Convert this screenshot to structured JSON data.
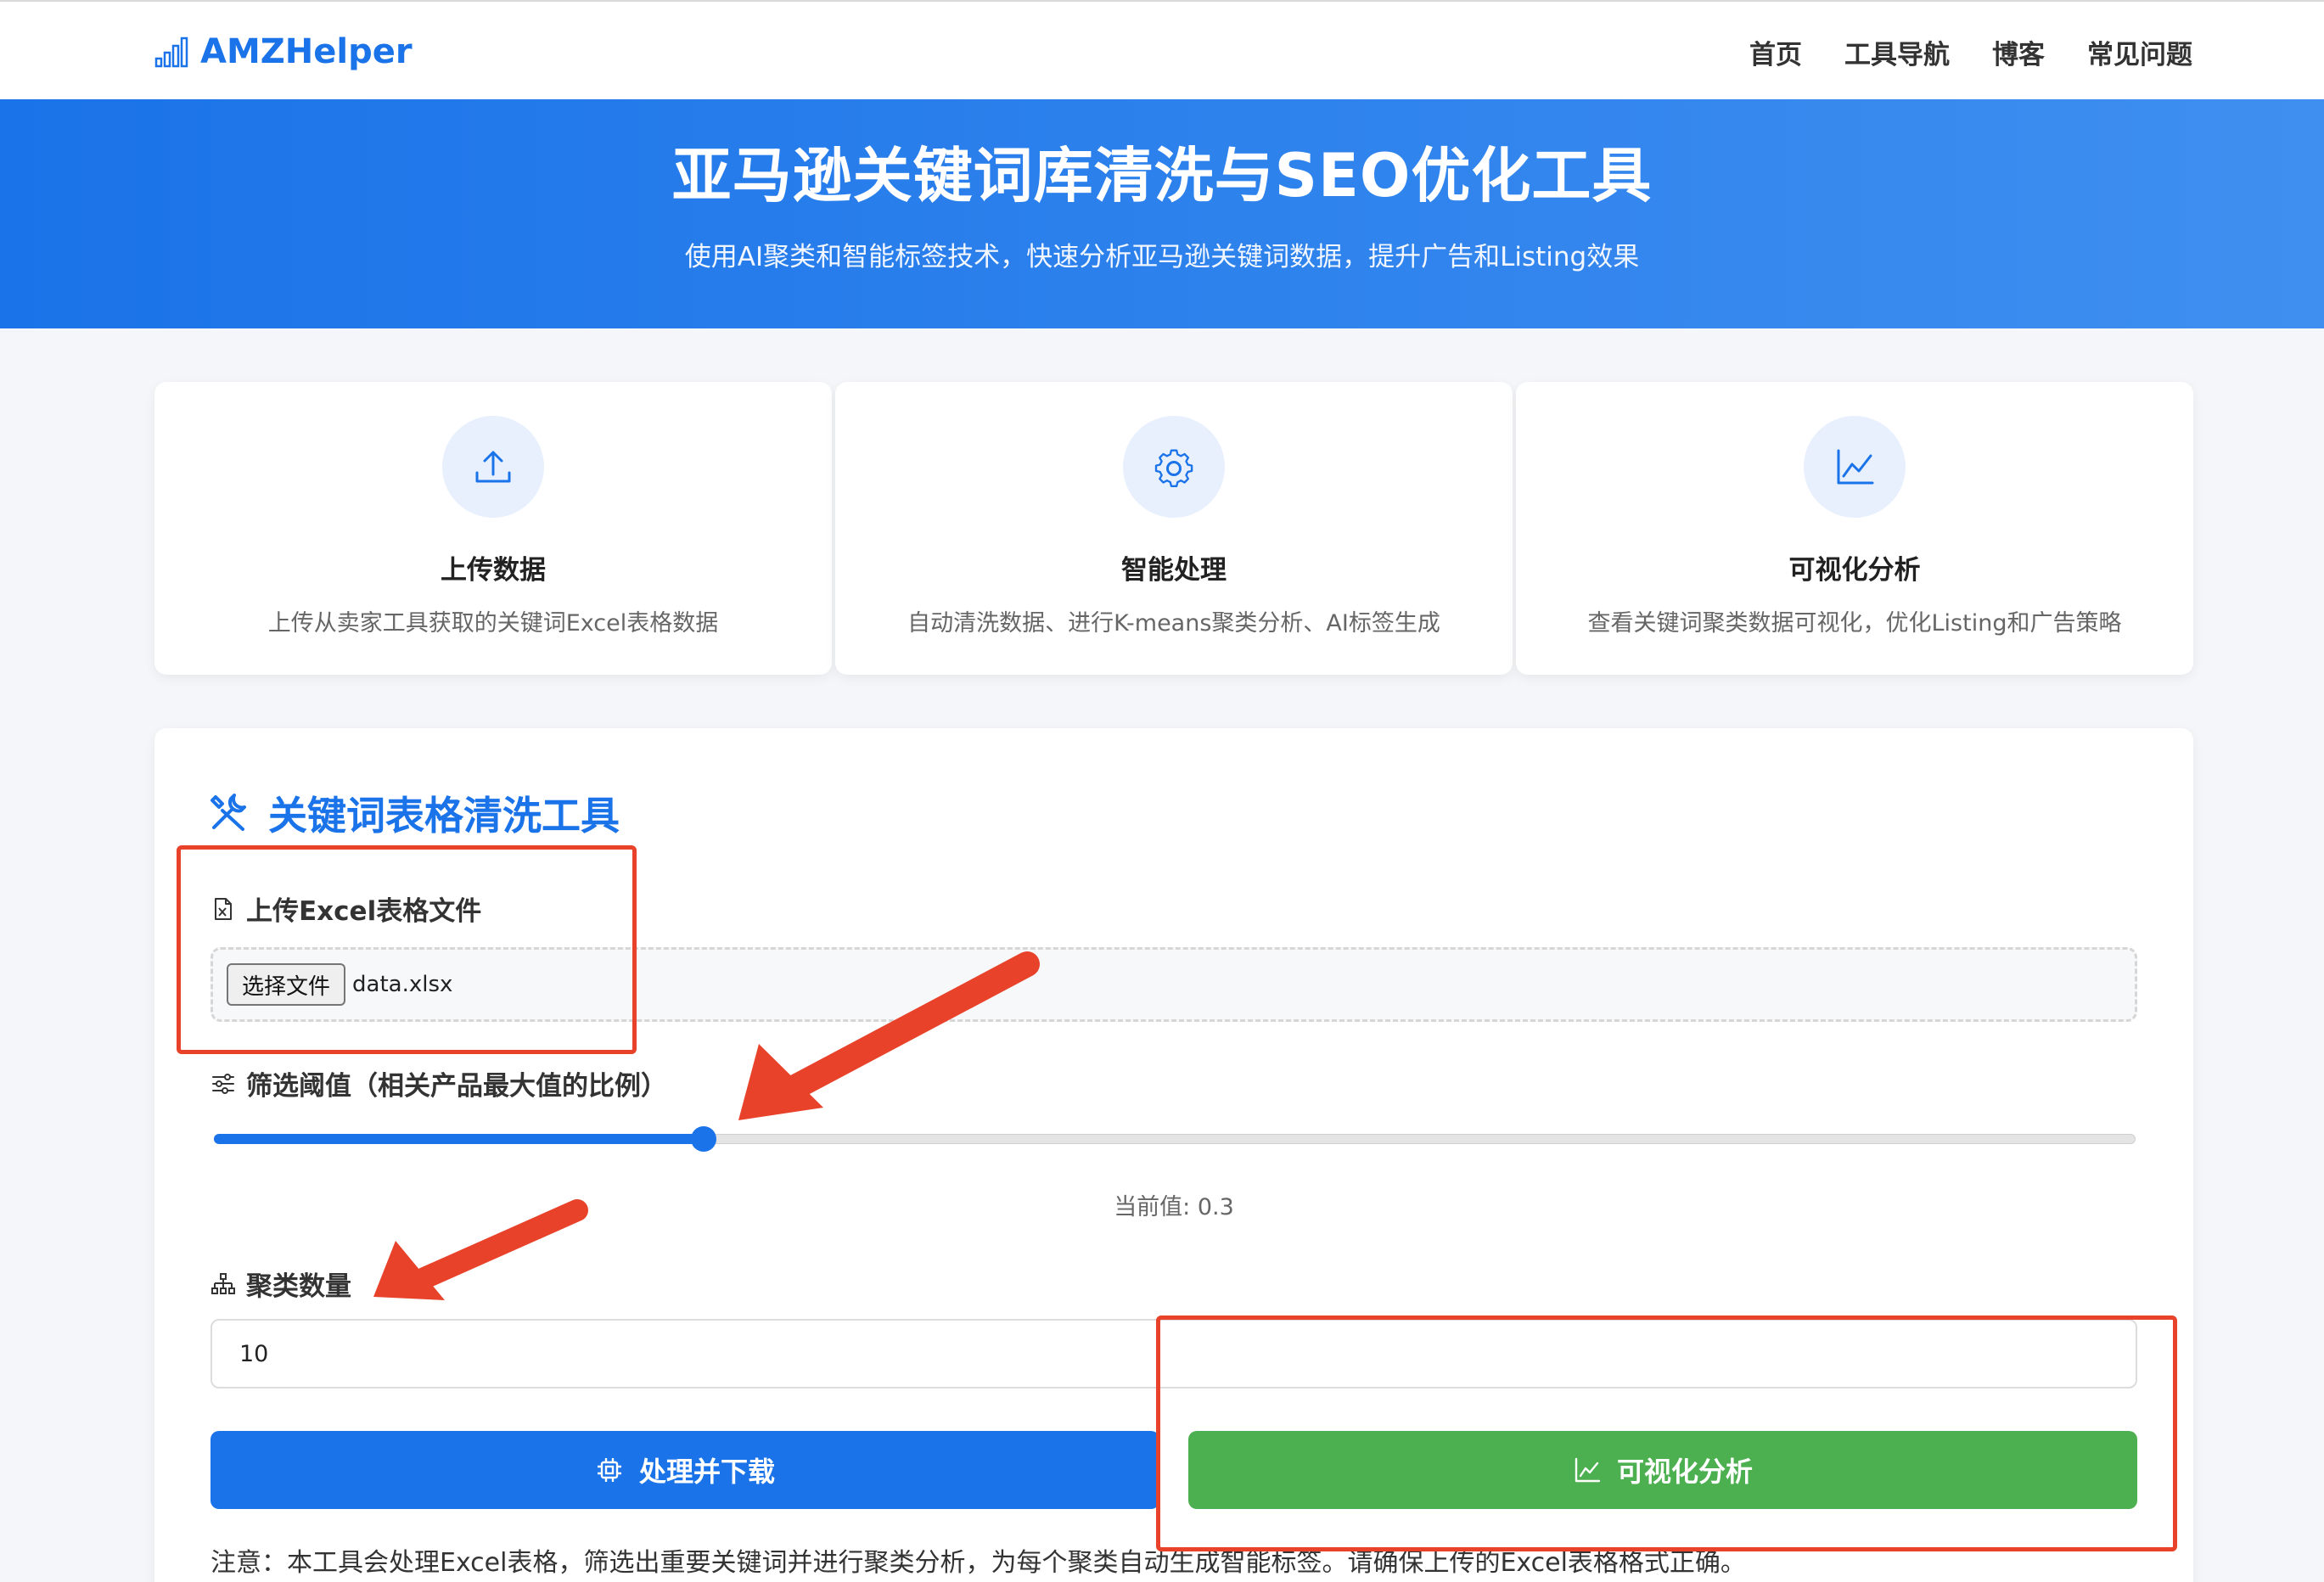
{
  "nav": {
    "brand": "AMZHelper",
    "links": [
      "首页",
      "工具导航",
      "博客",
      "常见问题"
    ]
  },
  "hero": {
    "title": "亚马逊关键词库清洗与SEO优化工具",
    "subtitle": "使用AI聚类和智能标签技术，快速分析亚马逊关键词数据，提升广告和Listing效果"
  },
  "features": [
    {
      "icon": "upload-icon",
      "title": "上传数据",
      "desc": "上传从卖家工具获取的关键词Excel表格数据"
    },
    {
      "icon": "gear-icon",
      "title": "智能处理",
      "desc": "自动清洗数据、进行K-means聚类分析、AI标签生成"
    },
    {
      "icon": "chart-line-icon",
      "title": "可视化分析",
      "desc": "查看关键词聚类数据可视化，优化Listing和广告策略"
    }
  ],
  "tool": {
    "title": "关键词表格清洗工具",
    "upload_label": "上传Excel表格文件",
    "file_button": "选择文件",
    "file_name": "data.xlsx",
    "threshold_label": "筛选阈值（相关产品最大值的比例）",
    "threshold_value": 0.3,
    "threshold_value_text": "当前值: 0.3",
    "cluster_label": "聚类数量",
    "cluster_value": "10",
    "process_button": "处理并下载",
    "visual_button": "可视化分析",
    "note": "注意：本工具会处理Excel表格，筛选出重要关键词并进行聚类分析，为每个聚类自动生成智能标签。请确保上传的Excel表格格式正确。"
  },
  "colors": {
    "primary": "#1a73e8",
    "success": "#4caf50",
    "annotation": "#e8432a"
  }
}
